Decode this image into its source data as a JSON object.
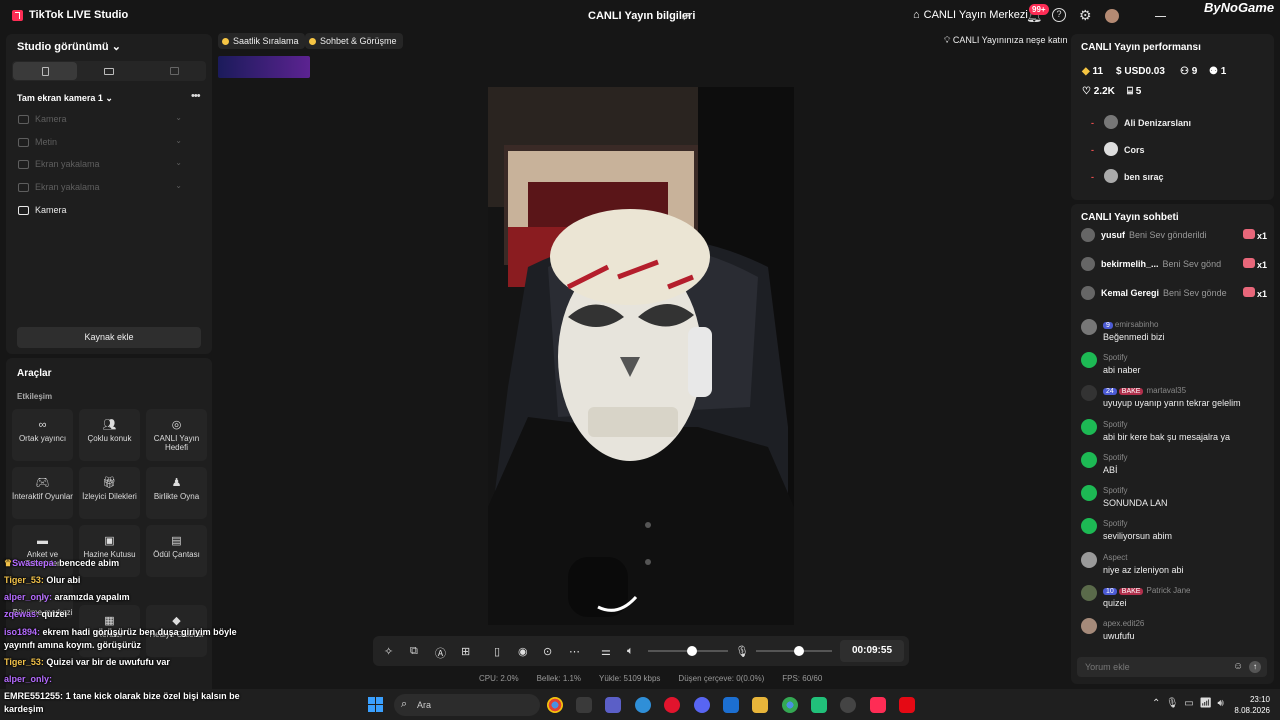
{
  "app": {
    "title": "TikTok LIVE Studio",
    "stream_info": "CANLI Yayın bilgileri",
    "live_center": "CANLI Yayın Merkezi",
    "notif_count": "99+",
    "watermark": "ByNoGame"
  },
  "left": {
    "studio_view": "Studio görünümü",
    "scene": "Tam ekran kamera 1",
    "sources": [
      "Kamera",
      "Metin",
      "Ekran yakalama",
      "Ekran yakalama",
      "Kamera"
    ],
    "add_source": "Kaynak ekle",
    "tools_title": "Araçlar",
    "interaction": "Etkileşim",
    "tools": [
      "Ortak yayıncı",
      "Çoklu konuk",
      "CANLI Yayın Hedefi",
      "İnteraktif Oyunlar",
      "İzleyici Dilekleri",
      "Birlikte Oyna",
      "Anket ve Tahminler",
      "Hazine Kutusu",
      "Ödül Çantası",
      "Büyüme merkezi",
      "Rehber",
      "Hediye Galerisi"
    ]
  },
  "stage": {
    "chip1": "Saatlik Sıralama",
    "chip2": "Sohbet & Görüşme",
    "tip": "CANLI Yayınınıza neşe katın",
    "timer": "00:09:55",
    "stats": [
      "CPU: 2.0%",
      "Bellek: 1.1%",
      "Yükle: 5109 kbps",
      "Düşen çerçeve: 0(0.0%)",
      "FPS: 60/60"
    ]
  },
  "perf": {
    "title": "CANLI Yayın performansı",
    "diamonds": "11",
    "usd": "USD0.03",
    "viewers": "9",
    "followers": "1",
    "likes": "2.2K",
    "gifts": "5",
    "top_viewers": [
      "Ali Denizarslanı",
      "Cors",
      "ben sıraç"
    ]
  },
  "chat": {
    "title": "CANLI Yayın sohbeti",
    "gifts": [
      {
        "user": "yusuf",
        "msg": "Beni Sev gönderildi",
        "count": "x1"
      },
      {
        "user": "bekirmelih_...",
        "msg": "Beni Sev gönd",
        "count": "x1"
      },
      {
        "user": "Kemal Geregi",
        "msg": "Beni Sev gönde",
        "count": "x1"
      }
    ],
    "messages": [
      {
        "name": "emirsabinho",
        "level": "9",
        "bake": "",
        "text": "Beğenmedi bizi",
        "spotify": false
      },
      {
        "name": "Spotify",
        "level": "",
        "bake": "",
        "text": "abi naber",
        "spotify": true
      },
      {
        "name": "martaval35",
        "level": "24",
        "bake": "BAKE",
        "text": "uyuyup uyanıp yarın tekrar gelelim",
        "spotify": false
      },
      {
        "name": "Spotify",
        "level": "",
        "bake": "",
        "text": "abi bir kere bak şu mesajalra ya",
        "spotify": true
      },
      {
        "name": "Spotify",
        "level": "",
        "bake": "",
        "text": "ABİ",
        "spotify": true
      },
      {
        "name": "Spotify",
        "level": "",
        "bake": "",
        "text": "SONUNDA LAN",
        "spotify": true
      },
      {
        "name": "Spotify",
        "level": "",
        "bake": "",
        "text": "seviliyorsun abim",
        "spotify": true
      },
      {
        "name": "Aspect",
        "level": "",
        "bake": "",
        "text": "niye az izleniyon abi",
        "spotify": false
      },
      {
        "name": "Patrick Jane",
        "level": "10",
        "bake": "BAKE",
        "text": "quizei",
        "spotify": false
      },
      {
        "name": "apex.edit26",
        "level": "",
        "bake": "",
        "text": "uwufufu",
        "spotify": false
      }
    ],
    "placeholder": "Yorum ekle"
  },
  "overlay": [
    {
      "name": "Swastepa:",
      "text": "bencede abim",
      "purple": true
    },
    {
      "name": "Tiger_53:",
      "text": "Olur abi",
      "purple": false
    },
    {
      "name": "alper_only:",
      "text": "aramızda yapalım",
      "purple": true
    },
    {
      "name": "zqewas:",
      "text": "quizei",
      "purple": true
    },
    {
      "name": "iso1894:",
      "text": "ekrem hadi görüşürüz ben duşa giriyim böyle",
      "purple": true
    },
    {
      "name": "",
      "text": "yayınıfı amına koyım. görüşürüz",
      "purple": false
    },
    {
      "name": "Tiger_53:",
      "text": "Quizei var bir de uwufufu var",
      "purple": false
    },
    {
      "name": "alper_only:",
      "text": "",
      "purple": true
    },
    {
      "name": "EMRE551255:",
      "text": "1 tane kick olarak bize özel bişi kalsın be",
      "purple": false
    },
    {
      "name": "",
      "text": "kardeşim",
      "purple": false
    }
  ],
  "taskbar": {
    "search": "Ara",
    "time": "23:10",
    "date": "8.08.2026"
  }
}
